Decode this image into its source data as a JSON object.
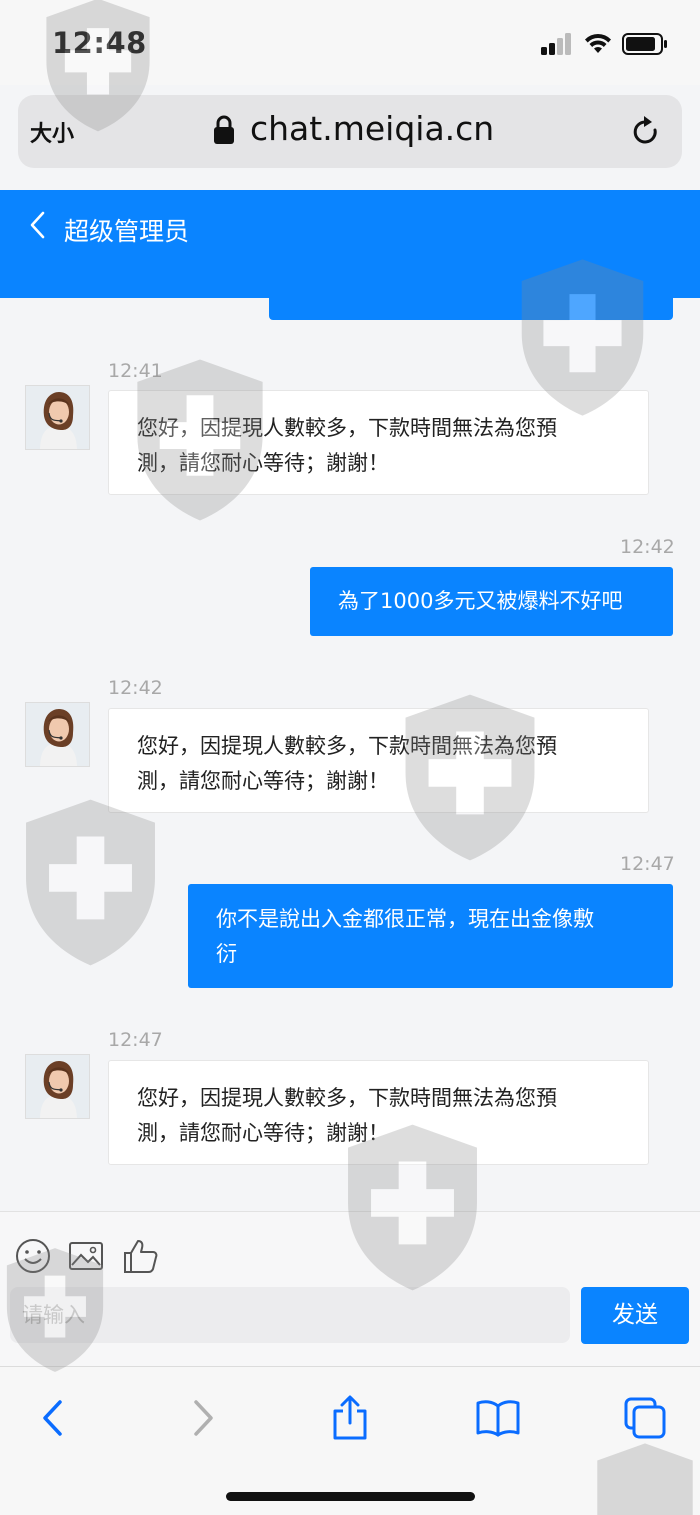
{
  "status_bar": {
    "time": "12:48"
  },
  "url_bar": {
    "text_size_label": "大小",
    "url": "chat.meiqia.cn"
  },
  "header": {
    "title": "超级管理员"
  },
  "messages": [
    {
      "from": "agent",
      "time": "12:41",
      "text_line1": "您好，因提現人數較多，下款時間無法為您預",
      "text_line2": "測，請您耐心等待；謝謝！"
    },
    {
      "from": "user",
      "time": "12:42",
      "text_line1": "為了1000多元又被爆料不好吧"
    },
    {
      "from": "agent",
      "time": "12:42",
      "text_line1": "您好，因提現人數較多，下款時間無法為您預",
      "text_line2": "測，請您耐心等待；謝謝！"
    },
    {
      "from": "user",
      "time": "12:47",
      "text_line1": "你不是說出入金都很正常，現在出金像敷",
      "text_line2": "衍"
    },
    {
      "from": "agent",
      "time": "12:47",
      "text_line1": "您好，因提現人數較多，下款時間無法為您預",
      "text_line2": "測，請您耐心等待；謝謝！"
    }
  ],
  "composer": {
    "placeholder": "请输入",
    "send_label": "发送"
  },
  "toolbar_icons": [
    "emoji-icon",
    "image-icon",
    "thumbs-up-icon"
  ],
  "browser_nav_icons": [
    "back-arrow-icon",
    "forward-arrow-icon",
    "share-icon",
    "bookmarks-icon",
    "tabs-icon"
  ],
  "colors": {
    "accent": "#0a84ff",
    "background": "#f4f5f7"
  }
}
